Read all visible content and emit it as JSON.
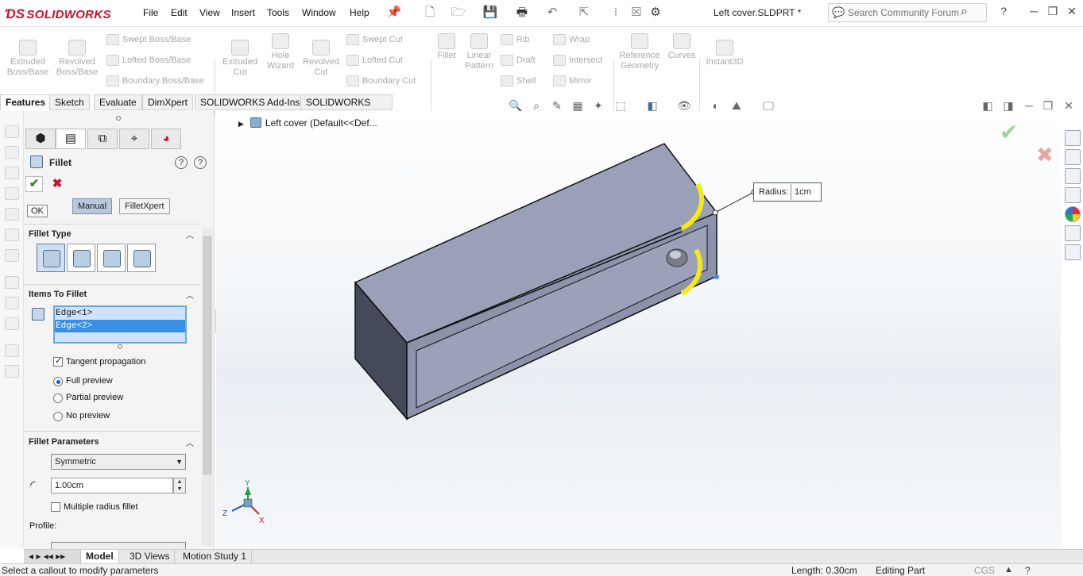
{
  "app": {
    "logo": "SOLIDWORKS",
    "doc_title": "Left cover.SLDPRT *"
  },
  "menu": [
    "File",
    "Edit",
    "View",
    "Insert",
    "Tools",
    "Window",
    "Help"
  ],
  "search": {
    "placeholder": "Search Community Forum"
  },
  "toolbar": {
    "extruded_boss": "Extruded\nBoss/Base",
    "revolved_boss": "Revolved\nBoss/Base",
    "swept_boss": "Swept Boss/Base",
    "lofted_boss": "Lofted Boss/Base",
    "boundary_boss": "Boundary Boss/Base",
    "extruded_cut": "Extruded\nCut",
    "hole_wizard": "Hole\nWizard",
    "revolved_cut": "Revolved\nCut",
    "swept_cut": "Swept Cut",
    "lofted_cut": "Lofted Cut",
    "boundary_cut": "Boundary Cut",
    "fillet": "Fillet",
    "linear_pattern": "Linear\nPattern",
    "rib": "Rib",
    "draft": "Draft",
    "shell": "Shell",
    "wrap": "Wrap",
    "intersect": "Intersect",
    "mirror": "Mirror",
    "reference_geometry": "Reference\nGeometry",
    "curves": "Curves",
    "instant3d": "Instant3D"
  },
  "tabs": [
    "Features",
    "Sketch",
    "Evaluate",
    "DimXpert",
    "SOLIDWORKS Add-Ins",
    "SOLIDWORKS MBD"
  ],
  "property_manager": {
    "title": "Fillet",
    "ok_tooltip": "OK",
    "mode_manual": "Manual",
    "mode_filletxpert": "FilletXpert",
    "fillet_type_header": "Fillet Type",
    "items_header": "Items To Fillet",
    "edges": [
      "Edge<1>",
      "Edge<2>"
    ],
    "tangent_propagation": "Tangent propagation",
    "full_preview": "Full preview",
    "partial_preview": "Partial preview",
    "no_preview": "No preview",
    "params_header": "Fillet Parameters",
    "symmetric": "Symmetric",
    "radius_value": "1.00cm",
    "multiple_radius": "Multiple radius fillet",
    "profile_label": "Profile:"
  },
  "tree": {
    "root": "Left cover  (Default<<Def..."
  },
  "callout": {
    "label": "Radius:",
    "value": "1cm"
  },
  "triad": {
    "x": "X",
    "y": "Y",
    "z": "Z"
  },
  "bottom_tabs": [
    "Model",
    "3D Views",
    "Motion Study 1"
  ],
  "status": {
    "message": "Select a callout to modify parameters",
    "length": "Length: 0.30cm",
    "mode": "Editing Part",
    "units": "CGS"
  },
  "colors": {
    "accent": "#c8102e",
    "selection": "#3a8ee6",
    "fillet_preview": "#f5ea14",
    "body": "#9aa0b8"
  }
}
